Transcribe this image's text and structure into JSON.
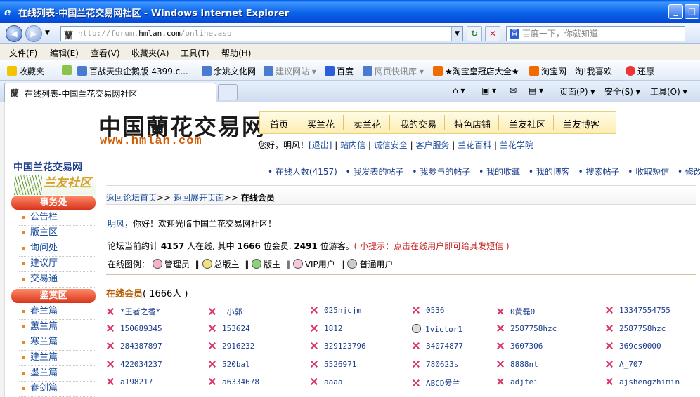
{
  "window": {
    "title": "在线列表-中国兰花交易网社区 - Windows Internet Explorer",
    "min": "_",
    "max": "□"
  },
  "nav": {
    "url_prefix": "http://forum.",
    "url_domain": "hmlan.com",
    "url_path": "/online.asp",
    "search_placeholder": "百度一下，你就知道",
    "favicon": "蘭",
    "search_icon": "百"
  },
  "menu": [
    "文件(F)",
    "编辑(E)",
    "查看(V)",
    "收藏夹(A)",
    "工具(T)",
    "帮助(H)"
  ],
  "favorites": {
    "label": "收藏夹",
    "items": [
      "百战天虫企鹅版-4399.c...",
      "余姚文化网",
      "建议网站 ▾",
      "百度",
      "网页快讯库 ▾",
      "★淘宝皇冠店大全★",
      "淘宝网 - 淘!我喜欢",
      "还原"
    ]
  },
  "tab": {
    "title": "在线列表-中国兰花交易网社区"
  },
  "commands": [
    "页面(P) ▾",
    "安全(S) ▾",
    "工具(O) ▾"
  ],
  "site": {
    "logo_cn": "中国蘭花交易网",
    "logo_url": "www.hmlan.com",
    "topnav": [
      "首页",
      "买兰花",
      "卖兰花",
      "我的交易",
      "特色店铺",
      "兰友社区",
      "兰友博客"
    ],
    "user": "您好，明风！",
    "logout": "[退出]",
    "userlinks": [
      "站内信",
      "诚信安全",
      "客户服务",
      "兰花百科",
      "兰花学院"
    ]
  },
  "sidebar": {
    "brand": "中国兰花交易网",
    "brand2": "兰友社区",
    "sec1": "事务处",
    "sec1_items": [
      "公告栏",
      "版主区",
      "询问处",
      "建议厅",
      "交易通"
    ],
    "sec2": "鉴赏区",
    "sec2_items": [
      "春兰篇",
      "蕙兰篇",
      "寒兰篇",
      "建兰篇",
      "墨兰篇",
      "春剑篇"
    ]
  },
  "quick": [
    "• 在线人数(4157)",
    "• 我发表的帖子",
    "• 我参与的帖子",
    "• 我的收藏",
    "• 我的博客",
    "• 搜索帖子",
    "• 收取短信",
    "• 修改资料"
  ],
  "breadcrumb": {
    "a": "返回论坛首页",
    "b": "返回展开页面",
    "sep": ">>",
    "c": "在线会员"
  },
  "welcome": {
    "name": "明风",
    "greet": "，你好！欢迎光临中国兰花交易网社区！",
    "stats_pre": "论坛当前约计 ",
    "total": "4157",
    "stats_mid1": " 人在线, 其中 ",
    "members": "1666",
    "stats_mid2": " 位会员, ",
    "guests": "2491",
    "stats_end": " 位游客。",
    "tip": "( 小提示：点击在线用户即可给其发短信 )",
    "legend_label": "在线图例：",
    "legend": [
      "管理员",
      "总版主",
      "版主",
      "VIP用户",
      "普通用户"
    ]
  },
  "online": {
    "title": "在线会员",
    "count": "( 1666人 )",
    "users": [
      "*王者之香*",
      "_小郭_",
      "025njcjm",
      "0536",
      "0黄磊0",
      "13347554755",
      "150689345",
      "153624",
      "1812",
      "1victor1",
      "2587758hzc",
      "2587758hzc",
      "284387897",
      "2916232",
      "329123796",
      "34074877",
      "3607306",
      "369cs0000",
      "422034237",
      "520bal",
      "5526971",
      "780623s",
      "8888nt",
      "A_707",
      "a198217",
      "a6334678",
      "aaaa",
      "ABCD爱兰",
      "adjfei",
      "ajshengzhimin"
    ]
  }
}
